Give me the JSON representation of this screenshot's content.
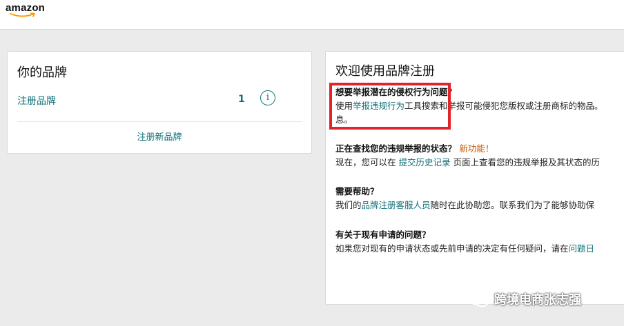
{
  "header": {
    "logo_text": "amazon"
  },
  "left_card": {
    "title": "你的品牌",
    "brand_row_label": "注册品牌",
    "brand_count": "1",
    "info_glyph": "i",
    "register_new_link": "注册新品牌"
  },
  "right_card": {
    "title": "欢迎使用品牌注册",
    "sections": [
      {
        "heading": "想要举报潜在的侵权行为问题？",
        "body_prefix": "使用",
        "body_link": "举报违规行为",
        "body_suffix": "工具搜索和举报可能侵犯您版权或注册商标的物品。",
        "body_line2": "息。"
      },
      {
        "heading": "正在查找您的违规举报的状态？",
        "heading_tag": "新功能！",
        "body_prefix": "现在，您可以在 ",
        "body_link": "提交历史记录",
        "body_suffix": " 页面上查看您的违规举报及其状态的历"
      },
      {
        "heading": "需要帮助？",
        "body_prefix": "我们的",
        "body_link": "品牌注册客服人员",
        "body_suffix": "随时在此协助您。联系我们为了能够协助保"
      },
      {
        "heading": "有关于现有申请的问题？",
        "body_prefix": "如果您对现有的申请状态或先前申请的决定有任何疑问，请在",
        "body_link": "问题日"
      }
    ]
  },
  "watermark": {
    "text": "跨境电商张志强",
    "icon": "wechat-icon"
  },
  "colors": {
    "link": "#0f6f77",
    "new_tag": "#c45500",
    "highlight_border": "#e0242a",
    "page_bg": "#ebebeb"
  }
}
